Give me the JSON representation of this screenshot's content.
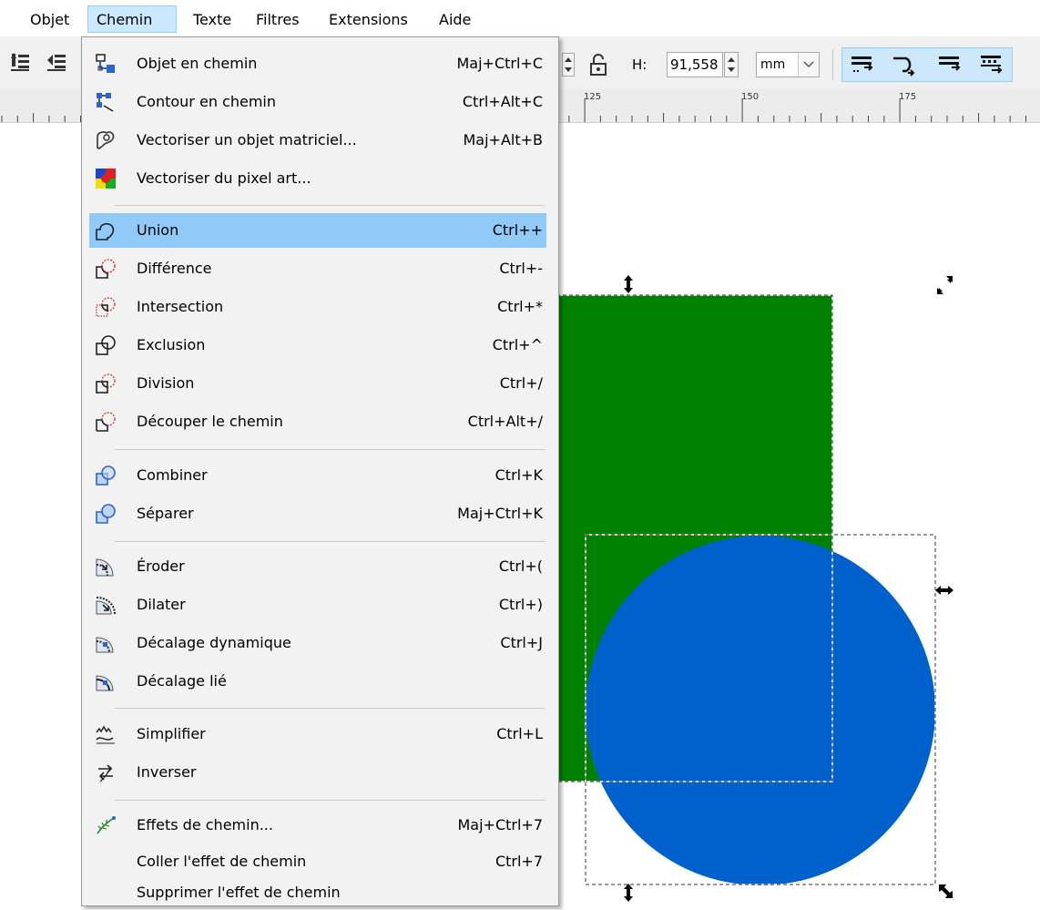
{
  "menubar": {
    "items": [
      "Objet",
      "Chemin",
      "Texte",
      "Filtres",
      "Extensions",
      "Aide"
    ]
  },
  "toolbar": {
    "h_label": "H:",
    "h_value": "91,558",
    "unit": "mm"
  },
  "ruler": {
    "labels": [
      "125",
      "150",
      "175"
    ]
  },
  "menu": {
    "items": [
      {
        "label": "Objet en chemin",
        "shortcut": "Maj+Ctrl+C",
        "icon": "object-to-path-icon"
      },
      {
        "label": "Contour en chemin",
        "shortcut": "Ctrl+Alt+C",
        "icon": "stroke-to-path-icon"
      },
      {
        "label": "Vectoriser un objet matriciel...",
        "shortcut": "Maj+Alt+B",
        "icon": "trace-bitmap-icon"
      },
      {
        "label": "Vectoriser du pixel art...",
        "shortcut": "",
        "icon": "trace-pixel-art-icon"
      },
      {
        "label": "Union",
        "shortcut": "Ctrl++",
        "icon": "union-icon"
      },
      {
        "label": "Différence",
        "shortcut": "Ctrl+-",
        "icon": "difference-icon"
      },
      {
        "label": "Intersection",
        "shortcut": "Ctrl+*",
        "icon": "intersection-icon"
      },
      {
        "label": "Exclusion",
        "shortcut": "Ctrl+^",
        "icon": "exclusion-icon"
      },
      {
        "label": "Division",
        "shortcut": "Ctrl+/",
        "icon": "division-icon"
      },
      {
        "label": "Découper le chemin",
        "shortcut": "Ctrl+Alt+/",
        "icon": "cut-path-icon"
      },
      {
        "label": "Combiner",
        "shortcut": "Ctrl+K",
        "icon": "combine-icon"
      },
      {
        "label": "Séparer",
        "shortcut": "Maj+Ctrl+K",
        "icon": "break-apart-icon"
      },
      {
        "label": "Éroder",
        "shortcut": "Ctrl+(",
        "icon": "inset-icon"
      },
      {
        "label": "Dilater",
        "shortcut": "Ctrl+)",
        "icon": "outset-icon"
      },
      {
        "label": "Décalage dynamique",
        "shortcut": "Ctrl+J",
        "icon": "dynamic-offset-icon"
      },
      {
        "label": "Décalage lié",
        "shortcut": "",
        "icon": "linked-offset-icon"
      },
      {
        "label": "Simplifier",
        "shortcut": "Ctrl+L",
        "icon": "simplify-icon"
      },
      {
        "label": "Inverser",
        "shortcut": "",
        "icon": "reverse-icon"
      },
      {
        "label": "Effets de chemin...",
        "shortcut": "Maj+Ctrl+7",
        "icon": "path-effects-icon"
      },
      {
        "label": "Coller l'effet de chemin",
        "shortcut": "Ctrl+7",
        "icon": ""
      },
      {
        "label": "Supprimer l'effet de chemin",
        "shortcut": "",
        "icon": ""
      }
    ]
  },
  "canvas": {
    "rect_color": "#008000",
    "circle_color": "#0060cc"
  },
  "colors": {
    "menu_highlight": "#91c9f7",
    "active_menubar": "#cce8ff"
  }
}
